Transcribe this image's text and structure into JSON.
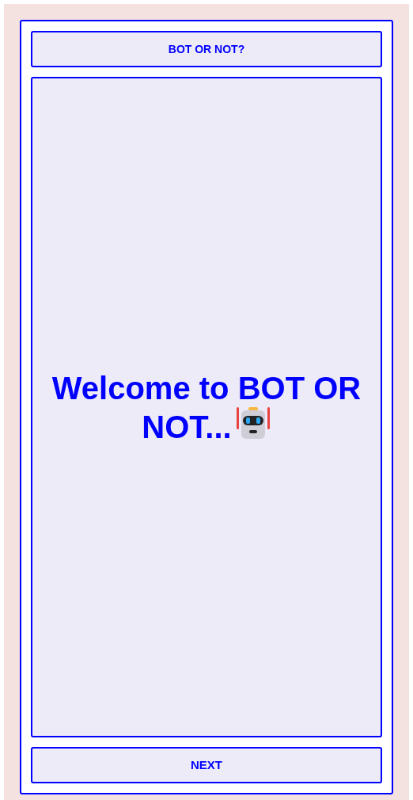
{
  "header": {
    "title": "BOT OR NOT?"
  },
  "welcome": {
    "text": "Welcome to BOT OR NOT..."
  },
  "next_button": {
    "label": "NEXT"
  }
}
